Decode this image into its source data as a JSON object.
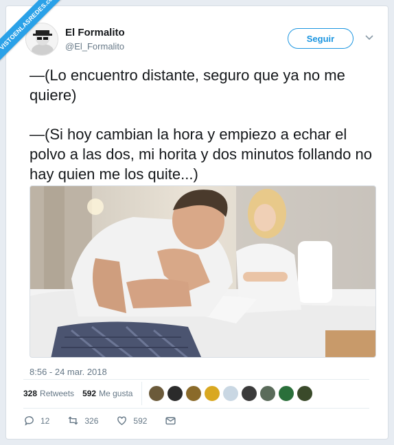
{
  "watermark": "VISTOENLASREDES.com",
  "user": {
    "name": "El Formalito",
    "handle": "@El_Formalito"
  },
  "follow_label": "Seguir",
  "tweet": {
    "paragraphs": [
      "—(Lo encuentro distante, seguro que ya no me quiere)",
      "—(Si hoy cambian la hora y empiezo a echar el polvo a las dos, mi horita y dos minutos follando no hay quien me los quite...)"
    ],
    "timestamp": "8:56 - 24 mar. 2018"
  },
  "stats": {
    "retweets_count": "328",
    "retweets_label": "Retweets",
    "likes_count": "592",
    "likes_label": "Me gusta"
  },
  "liker_colors": [
    "#6b5a3a",
    "#2b2b2b",
    "#8a6a2a",
    "#d9a820",
    "#c9d7e3",
    "#3a3a3a",
    "#5a6b5a",
    "#2a6f3a",
    "#3a4a2a"
  ],
  "actions": {
    "reply_count": "12",
    "retweet_count": "326",
    "like_count": "592"
  },
  "colors": {
    "accent": "#1b95e0",
    "muted": "#657786",
    "text": "#14171a",
    "ribbon": "#2aa1e8"
  }
}
